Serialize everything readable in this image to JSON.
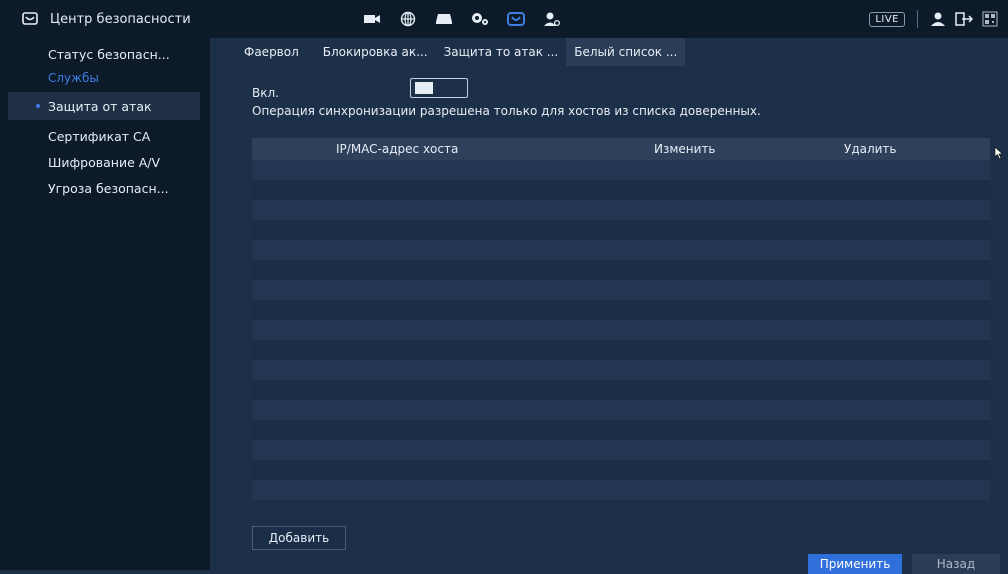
{
  "header": {
    "title": "Центр безопасности",
    "live_label": "LIVE"
  },
  "sidebar": {
    "items": [
      {
        "label": "Статус безопасн...",
        "type": "item"
      },
      {
        "label": "Службы",
        "type": "group"
      },
      {
        "label": "Защита от атак",
        "type": "item",
        "active": true
      },
      {
        "label": "Сертификат CA",
        "type": "item"
      },
      {
        "label": "Шифрование A/V",
        "type": "item"
      },
      {
        "label": "Угроза безопасн...",
        "type": "item"
      }
    ]
  },
  "tabs": [
    {
      "label": "Фаервол"
    },
    {
      "label": "Блокировка ак..."
    },
    {
      "label": "Защита то атак ..."
    },
    {
      "label": "Белый список ...",
      "active": true
    }
  ],
  "form": {
    "enable_label": "Вкл.",
    "enabled": true,
    "note": "Операция синхронизации разрешена только для хостов из списка доверенных."
  },
  "table": {
    "columns": [
      "IP/MAC-адрес хоста",
      "Изменить",
      "Удалить"
    ],
    "rows": []
  },
  "buttons": {
    "add": "Добавить",
    "apply": "Применить",
    "back": "Назад"
  },
  "colors": {
    "accent": "#2f6fdc",
    "background": "#1d3049",
    "sidebar": "#0d1a2a"
  }
}
